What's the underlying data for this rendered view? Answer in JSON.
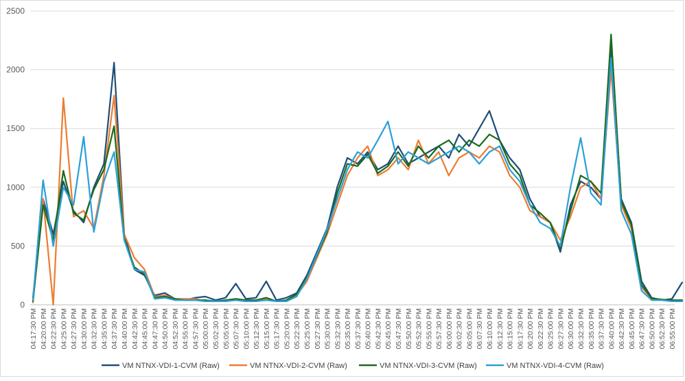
{
  "chart_data": {
    "type": "line",
    "title": "",
    "xlabel": "",
    "ylabel": "",
    "ylim": [
      0,
      2500
    ],
    "yticks": [
      0,
      500,
      1000,
      1500,
      2000,
      2500
    ],
    "grid": "horizontal",
    "legend_position": "bottom",
    "x_tick_labels": [
      "04:17:30 PM",
      "04:20:00 PM",
      "04:22:30 PM",
      "04:25:00 PM",
      "04:27:30 PM",
      "04:30:00 PM",
      "04:32:30 PM",
      "04:35:00 PM",
      "04:37:30 PM",
      "04:40:00 PM",
      "04:42:30 PM",
      "04:45:00 PM",
      "04:47:30 PM",
      "04:50:00 PM",
      "04:52:30 PM",
      "04:55:00 PM",
      "04:57:30 PM",
      "05:00:00 PM",
      "05:02:30 PM",
      "05:05:00 PM",
      "05:07:30 PM",
      "05:10:00 PM",
      "05:12:30 PM",
      "05:15:00 PM",
      "05:17:30 PM",
      "05:20:00 PM",
      "05:22:30 PM",
      "05:25:00 PM",
      "05:27:30 PM",
      "05:30:00 PM",
      "05:32:30 PM",
      "05:35:00 PM",
      "05:37:30 PM",
      "05:40:00 PM",
      "05:42:30 PM",
      "05:45:00 PM",
      "05:47:30 PM",
      "05:50:00 PM",
      "05:52:30 PM",
      "05:55:00 PM",
      "05:57:30 PM",
      "06:00:00 PM",
      "06:02:30 PM",
      "06:05:00 PM",
      "06:07:30 PM",
      "06:10:00 PM",
      "06:12:30 PM",
      "06:15:00 PM",
      "06:17:30 PM",
      "06:20:00 PM",
      "06:22:30 PM",
      "06:25:00 PM",
      "06:27:30 PM",
      "06:30:00 PM",
      "06:32:30 PM",
      "06:35:00 PM",
      "06:37:30 PM",
      "06:40:00 PM",
      "06:42:30 PM",
      "06:45:00 PM",
      "06:47:30 PM",
      "06:50:00 PM",
      "06:52:30 PM",
      "06:55:00 PM"
    ],
    "series": [
      {
        "name": "VM NTNX-VDI-1-CVM (Raw)",
        "color": "#1f4e79",
        "values": [
          60,
          900,
          600,
          1050,
          800,
          700,
          1000,
          1200,
          2060,
          600,
          300,
          250,
          80,
          100,
          50,
          40,
          60,
          70,
          40,
          60,
          180,
          50,
          60,
          200,
          40,
          60,
          100,
          250,
          450,
          650,
          1000,
          1250,
          1200,
          1300,
          1150,
          1200,
          1350,
          1200,
          1250,
          1300,
          1350,
          1250,
          1450,
          1350,
          1500,
          1650,
          1400,
          1250,
          1150,
          900,
          750,
          700,
          450,
          850,
          1050,
          1000,
          900,
          2200,
          900,
          700,
          200,
          60,
          40,
          50,
          190
        ]
      },
      {
        "name": "VM NTNX-VDI-2-CVM (Raw)",
        "color": "#ed7d31",
        "values": [
          20,
          900,
          0,
          1760,
          750,
          800,
          650,
          1100,
          1780,
          600,
          400,
          300,
          70,
          80,
          50,
          50,
          50,
          30,
          30,
          40,
          40,
          30,
          30,
          50,
          30,
          30,
          80,
          200,
          400,
          600,
          850,
          1100,
          1250,
          1350,
          1100,
          1150,
          1250,
          1150,
          1400,
          1200,
          1300,
          1100,
          1250,
          1300,
          1250,
          1350,
          1300,
          1100,
          1000,
          800,
          750,
          700,
          550,
          750,
          1000,
          1050,
          900,
          2000,
          850,
          650,
          150,
          50,
          40,
          30,
          30
        ]
      },
      {
        "name": "VM NTNX-VDI-3-CVM (Raw)",
        "color": "#1b6b1b",
        "values": [
          30,
          850,
          550,
          1140,
          780,
          720,
          980,
          1150,
          1520,
          560,
          320,
          260,
          60,
          70,
          50,
          40,
          40,
          40,
          30,
          40,
          50,
          40,
          40,
          60,
          30,
          40,
          90,
          230,
          420,
          620,
          950,
          1200,
          1180,
          1280,
          1120,
          1180,
          1300,
          1180,
          1350,
          1250,
          1350,
          1400,
          1300,
          1400,
          1350,
          1450,
          1400,
          1200,
          1100,
          850,
          780,
          700,
          480,
          800,
          1100,
          1050,
          950,
          2300,
          880,
          680,
          170,
          55,
          45,
          40,
          40
        ]
      },
      {
        "name": "VM NTNX-VDI-4-CVM (Raw)",
        "color": "#2e9fd8",
        "values": [
          40,
          1060,
          500,
          1000,
          850,
          1430,
          620,
          1050,
          1300,
          550,
          300,
          280,
          50,
          60,
          40,
          40,
          40,
          30,
          30,
          30,
          40,
          30,
          30,
          40,
          30,
          30,
          70,
          220,
          430,
          640,
          900,
          1150,
          1300,
          1250,
          1400,
          1560,
          1200,
          1300,
          1250,
          1200,
          1250,
          1300,
          1350,
          1300,
          1200,
          1300,
          1350,
          1150,
          1050,
          850,
          700,
          650,
          500,
          1000,
          1420,
          950,
          850,
          2100,
          800,
          600,
          120,
          40,
          40,
          30,
          30
        ]
      }
    ]
  }
}
